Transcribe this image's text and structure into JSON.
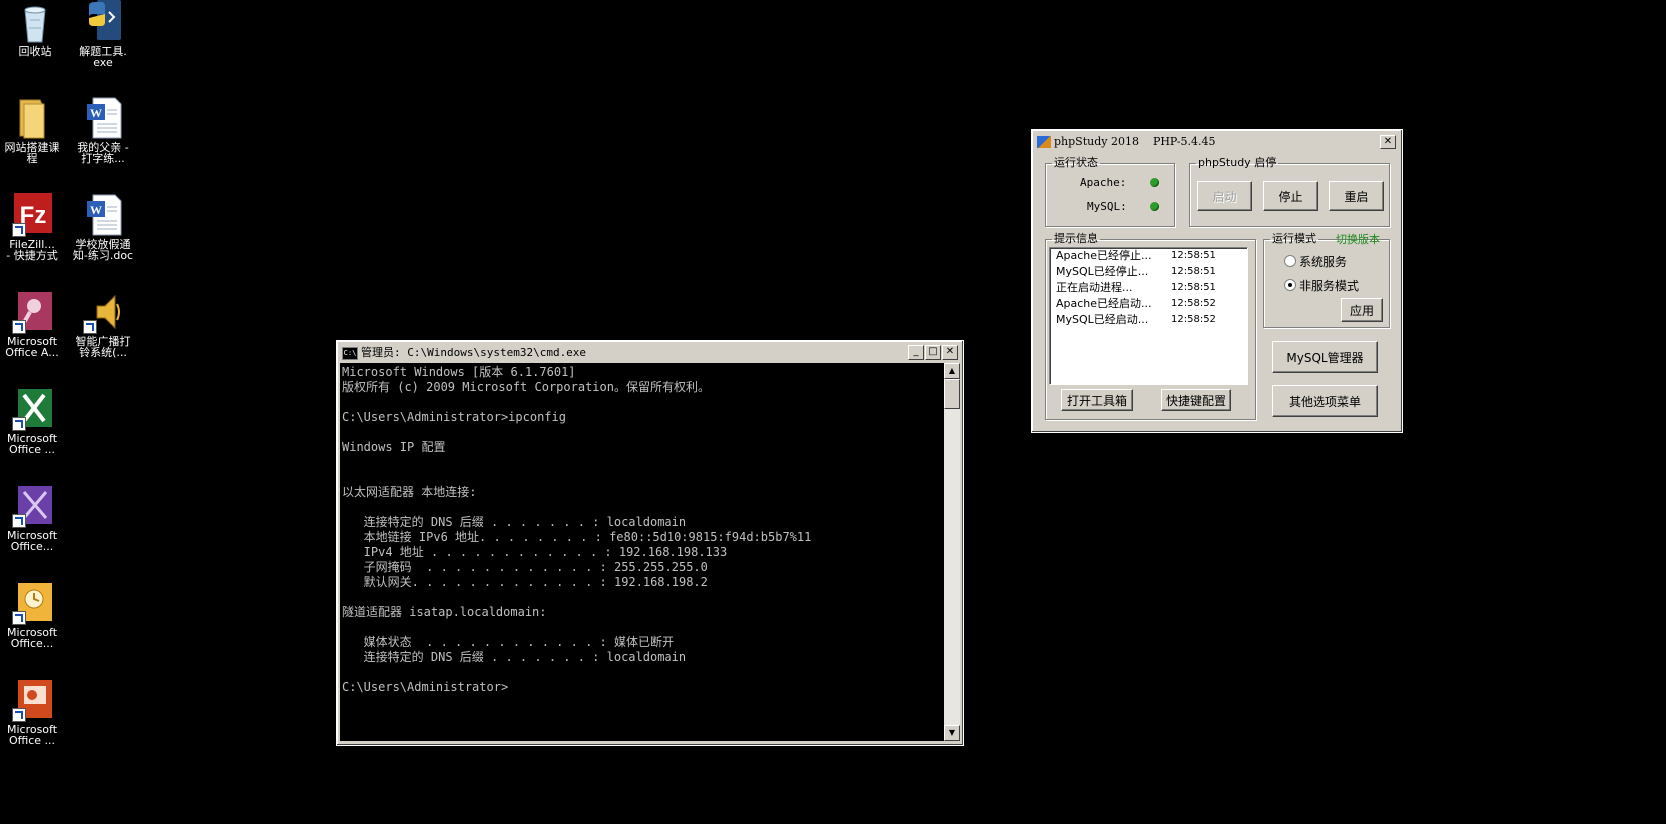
{
  "desktop": {
    "icons": [
      {
        "label": "回收站",
        "icon": "recycle-bin-icon"
      },
      {
        "label": "解题工具.\nexe",
        "icon": "python-exe-icon"
      },
      {
        "label": "网站搭建课\n程",
        "icon": "folder-icon"
      },
      {
        "label": "我的父亲 -\n打字练...",
        "icon": "word-doc-icon"
      },
      {
        "label": "FileZill...\n- 快捷方式",
        "icon": "filezilla-icon"
      },
      {
        "label": "学校放假通\n知-练习.doc",
        "icon": "word-doc-icon"
      },
      {
        "label": "Microsoft\nOffice A...",
        "icon": "access-icon"
      },
      {
        "label": "智能广播打\n铃系统(...",
        "icon": "speaker-icon"
      },
      {
        "label": "Microsoft\nOffice ...",
        "icon": "excel-icon"
      },
      {
        "label": "Microsoft\nOffice...",
        "icon": "infopath-icon"
      },
      {
        "label": "Microsoft\nOffice...",
        "icon": "outlook-icon"
      },
      {
        "label": "Microsoft\nOffice ...",
        "icon": "powerpoint-icon"
      }
    ]
  },
  "cmd": {
    "title": "管理员: C:\\Windows\\system32\\cmd.exe",
    "minimize": "_",
    "maximize": "□",
    "close": "✕",
    "lines": [
      "Microsoft Windows [版本 6.1.7601]",
      "版权所有 (c) 2009 Microsoft Corporation。保留所有权利。",
      "",
      "C:\\Users\\Administrator>ipconfig",
      "",
      "Windows IP 配置",
      "",
      "",
      "以太网适配器 本地连接:",
      "",
      "   连接特定的 DNS 后缀 . . . . . . . : localdomain",
      "   本地链接 IPv6 地址. . . . . . . . : fe80::5d10:9815:f94d:b5b7%11",
      "   IPv4 地址 . . . . . . . . . . . . : 192.168.198.133",
      "   子网掩码  . . . . . . . . . . . . : 255.255.255.0",
      "   默认网关. . . . . . . . . . . . . : 192.168.198.2",
      "",
      "隧道适配器 isatap.localdomain:",
      "",
      "   媒体状态  . . . . . . . . . . . . : 媒体已断开",
      "   连接特定的 DNS 后缀 . . . . . . . : localdomain",
      "",
      "C:\\Users\\Administrator>"
    ]
  },
  "php": {
    "title": "phpStudy 2018    PHP-5.4.45",
    "close": "✕",
    "status_group": "运行状态",
    "apache_label": "Apache:",
    "mysql_label": "MySQL:",
    "status_color": "#2e9b2e",
    "control_group": "phpStudy 启停",
    "start": "启动",
    "stop": "停止",
    "restart": "重启",
    "log_group": "提示信息",
    "log": [
      {
        "msg": "Apache已经停止...",
        "time": "12:58:51"
      },
      {
        "msg": "MySQL已经停止...",
        "time": "12:58:51"
      },
      {
        "msg": "正在启动进程...",
        "time": "12:58:51"
      },
      {
        "msg": "Apache已经启动...",
        "time": "12:58:52"
      },
      {
        "msg": "MySQL已经启动...",
        "time": "12:58:52"
      }
    ],
    "open_toolbox": "打开工具箱",
    "shortcut_config": "快捷键配置",
    "mode_group": "运行模式",
    "switch_version": "切换版本",
    "switch_color": "#1a8a1a",
    "mode_service": "系统服务",
    "mode_nonservice": "非服务模式",
    "apply": "应用",
    "mysql_manager": "MySQL管理器",
    "other_menu": "其他选项菜单"
  }
}
